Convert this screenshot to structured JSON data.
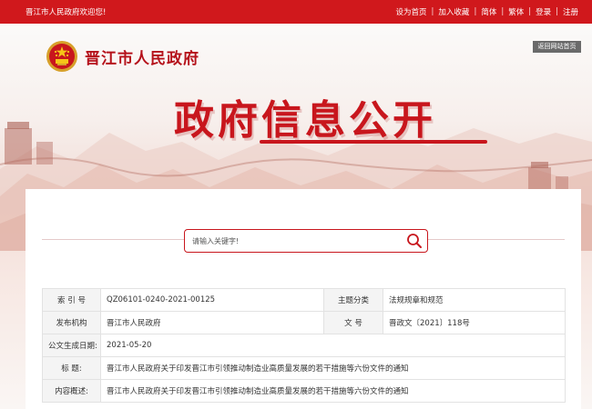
{
  "topbar": {
    "welcome": "晋江市人民政府欢迎您!",
    "links": [
      "设为首页",
      "加入收藏",
      "简体",
      "繁体",
      "登录",
      "注册"
    ]
  },
  "header": {
    "site_name": "晋江市人民政府",
    "back_home": "返回网站首页",
    "page_title": "政府信息公开"
  },
  "search": {
    "placeholder": "请输入关键字!"
  },
  "info_table": {
    "index_label": "索 引 号",
    "index_value": "QZ06101-0240-2021-00125",
    "category_label": "主题分类",
    "category_value": "法规规章和规范",
    "issuer_label": "发布机构",
    "issuer_value": "晋江市人民政府",
    "doc_no_label": "文 号",
    "doc_no_value": "晋政文〔2021〕118号",
    "date_label": "公文生成日期:",
    "date_value": "2021-05-20",
    "title_label": "标 题:",
    "title_value": "晋江市人民政府关于印发晋江市引领推动制造业高质量发展的若干措施等六份文件的通知",
    "summary_label": "内容概述:",
    "summary_value": "晋江市人民政府关于印发晋江市引领推动制造业高质量发展的若干措施等六份文件的通知"
  },
  "colors": {
    "brand_red": "#c8161d",
    "topbar_red": "#d0181c"
  }
}
